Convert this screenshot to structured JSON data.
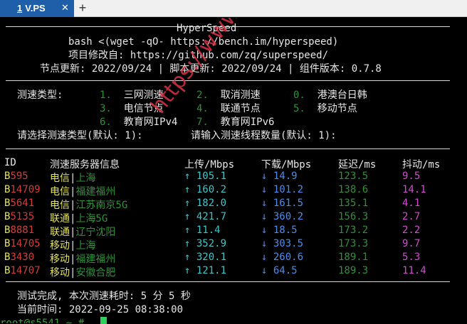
{
  "tabbar": {
    "tab_number": "1",
    "tab_title": "V.PS",
    "close_glyph": "✕",
    "new_tab_glyph": "+"
  },
  "header": {
    "title": "HyperSpeed",
    "cmd": "bash <(wget -qO- https://bench.im/hyperspeed)",
    "repo": "项目修改自: https://github.com/zq/superspeed/",
    "updates": "节点更新: 2022/09/24 | 脚本更新: 2022/09/24 | 组件版本: 0.7.8"
  },
  "menu": {
    "label": "测速类型:",
    "options": [
      {
        "num": "1.",
        "text": "三网测速"
      },
      {
        "num": "2.",
        "text": "取消测速"
      },
      {
        "num": "0.",
        "text": "港澳台日韩"
      },
      {
        "num": "3.",
        "text": "电信节点"
      },
      {
        "num": "4.",
        "text": "联通节点"
      },
      {
        "num": "5.",
        "text": "移动节点"
      },
      {
        "num": "6.",
        "text": "教育网IPv4"
      },
      {
        "num": "7.",
        "text": "教育网IPv6"
      }
    ],
    "prompt1": "请选择测速类型(默认: 1):",
    "prompt2": "请输入测速线程数量(默认: 1):"
  },
  "table": {
    "headers": [
      "ID",
      "测速服务器信息",
      "上传/Mbps",
      "下载/Mbps",
      "延迟/ms",
      "抖动/ms"
    ],
    "rows": [
      {
        "id": "595",
        "isp": "电信",
        "loc": "上海",
        "up": "105.1",
        "down": "14.9",
        "lat": "123.5",
        "jit": "9.5"
      },
      {
        "id": "14709",
        "isp": "电信",
        "loc": "福建福州",
        "up": "160.2",
        "down": "101.2",
        "lat": "138.6",
        "jit": "14.1"
      },
      {
        "id": "5641",
        "isp": "电信",
        "loc": "江苏南京5G",
        "up": "182.0",
        "down": "161.5",
        "lat": "135.1",
        "jit": "4.1"
      },
      {
        "id": "5135",
        "isp": "联通",
        "loc": "上海5G",
        "up": "421.7",
        "down": "360.2",
        "lat": "156.3",
        "jit": "2.7"
      },
      {
        "id": "8881",
        "isp": "联通",
        "loc": "辽宁沈阳",
        "up": "11.4",
        "down": "18.5",
        "lat": "173.2",
        "jit": "2.2"
      },
      {
        "id": "14705",
        "isp": "移动",
        "loc": "上海",
        "up": "352.9",
        "down": "303.5",
        "lat": "173.3",
        "jit": "9.7"
      },
      {
        "id": "3430",
        "isp": "移动",
        "loc": "福建福州",
        "up": "320.1",
        "down": "260.6",
        "lat": "189.1",
        "jit": "5.3"
      },
      {
        "id": "14707",
        "isp": "移动",
        "loc": "安徽合肥",
        "up": "121.1",
        "down": "64.5",
        "lat": "189.3",
        "jit": "11.4"
      }
    ],
    "id_prefix": "B",
    "sep": "|",
    "up_arrow": "↑",
    "down_arrow": "↓"
  },
  "footer": {
    "done": "测试完成, 本次测速耗时: 5 分 5 秒",
    "time": "当前时间: 2022-09-25 08:38:00",
    "prompt_partial": "root@s5541 ~ #"
  },
  "watermark": "https://www.vpsc.com"
}
